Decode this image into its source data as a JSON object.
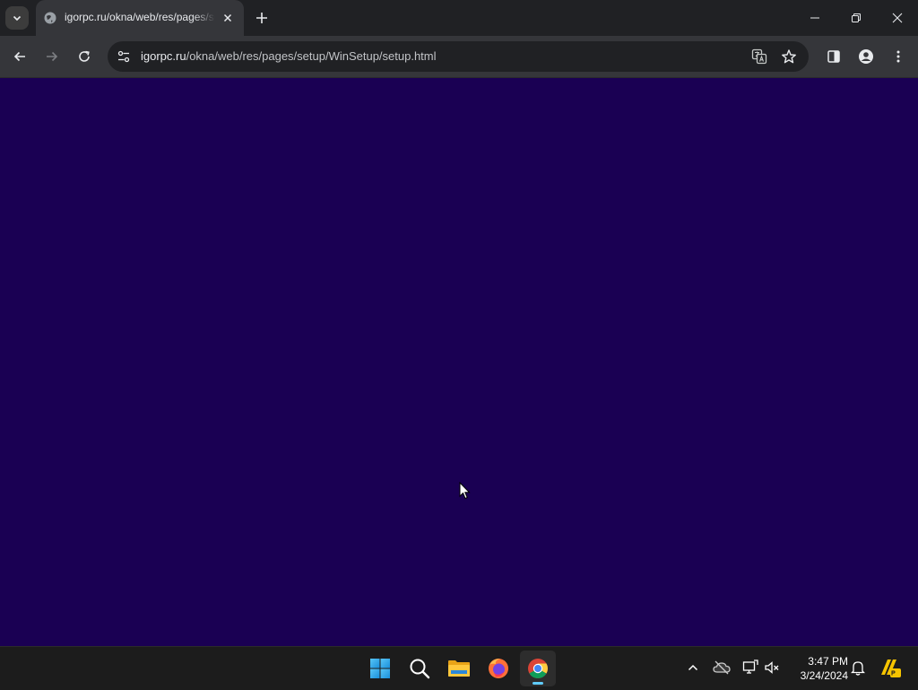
{
  "browser": {
    "tab": {
      "title": "igorpc.ru/okna/web/res/pages/setup/WinSetup/setup.html",
      "favicon": "globe-icon"
    },
    "address_bar": {
      "host": "igorpc.ru",
      "path": "/okna/web/res/pages/setup/WinSetup/setup.html"
    },
    "icons": {
      "tab_search": "chevron-down-icon",
      "close_tab": "close-icon",
      "new_tab": "plus-icon",
      "back": "arrow-left-icon",
      "forward": "arrow-right-icon",
      "reload": "reload-icon",
      "site_info": "tune-icon",
      "translate": "translate-icon",
      "bookmark": "star-icon",
      "side_panel": "side-panel-icon",
      "profile": "profile-icon",
      "menu": "kebab-menu-icon",
      "minimize": "minimize-icon",
      "restore": "restore-icon",
      "close_window": "close-window-icon"
    }
  },
  "page": {
    "background": "#1a0053"
  },
  "taskbar": {
    "apps": [
      "start-icon",
      "search-icon",
      "file-explorer-icon",
      "firefox-icon",
      "chrome-icon"
    ],
    "active_app": "chrome",
    "tray": [
      "chevron-up-icon",
      "onedrive-offline-icon",
      "network-icon",
      "volume-muted-icon",
      "notification-icon",
      "norton-icon"
    ],
    "clock": {
      "time": "3:47 PM",
      "date": "3/24/2024"
    }
  },
  "colors": {
    "tabstrip": "#202124",
    "toolbar": "#35363a",
    "taskbar": "#1c1c1c",
    "accent": "#60cdff"
  }
}
